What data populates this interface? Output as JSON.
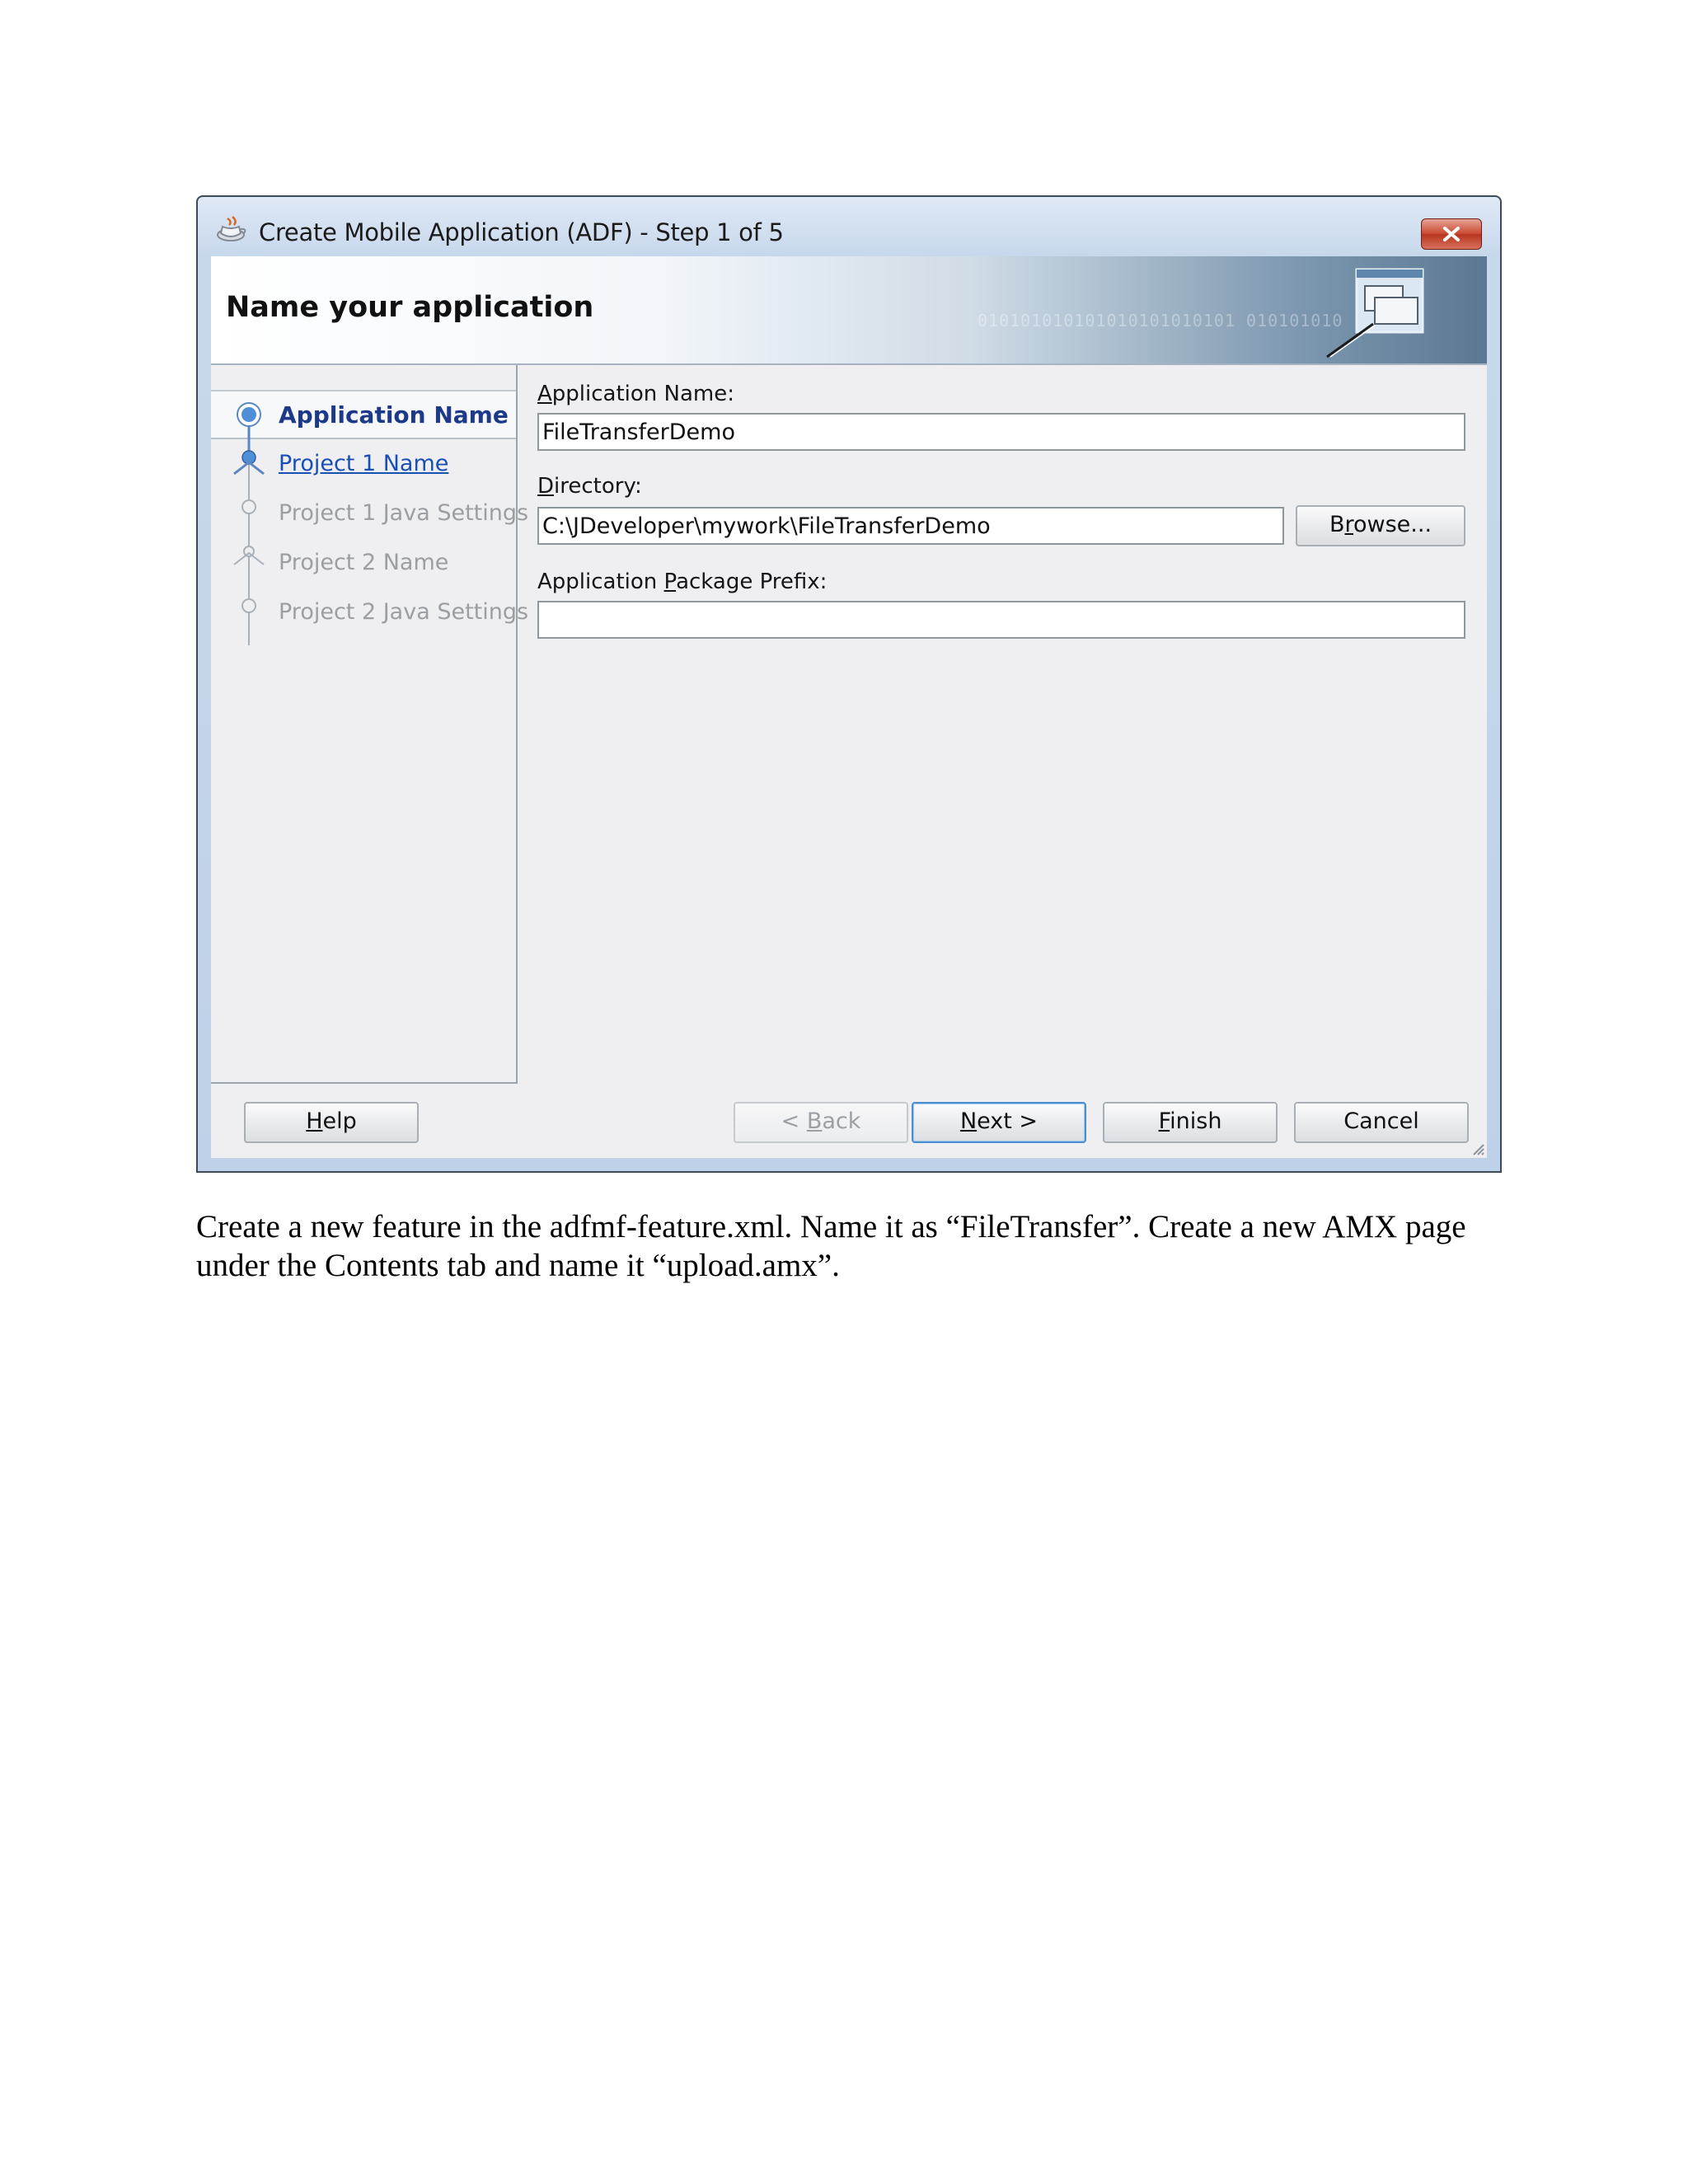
{
  "window": {
    "title": "Create Mobile Application (ADF) - Step 1 of 5",
    "header_title": "Name your application",
    "header_decoration": "010101010101010101010101 010101010"
  },
  "steps": [
    {
      "label": "Application Name",
      "state": "active"
    },
    {
      "label": "Project 1 Name",
      "state": "link"
    },
    {
      "label": "Project 1 Java Settings",
      "state": "disabled"
    },
    {
      "label": "Project 2 Name",
      "state": "disabled"
    },
    {
      "label": "Project 2 Java Settings",
      "state": "disabled"
    }
  ],
  "form": {
    "app_name_label_m": "A",
    "app_name_label_rest": "pplication Name:",
    "app_name_value": "FileTransferDemo",
    "directory_label_m": "D",
    "directory_label_rest": "irectory:",
    "directory_value": "C:\\JDeveloper\\mywork\\FileTransferDemo",
    "browse_pre": "B",
    "browse_m": "r",
    "browse_post": "owse...",
    "prefix_label_pre": "Application ",
    "prefix_label_m": "P",
    "prefix_label_post": "ackage Prefix:",
    "prefix_value": ""
  },
  "buttons": {
    "help_m": "H",
    "help_rest": "elp",
    "back_pre": "< ",
    "back_m": "B",
    "back_post": "ack",
    "next_m": "N",
    "next_post": "ext >",
    "finish_m": "F",
    "finish_post": "inish",
    "cancel": "Cancel"
  },
  "caption": "Create a new feature in the adfmf-feature.xml. Name it as “FileTransfer”. Create a new AMX page under the Contents tab and name it “upload.amx”.",
  "colors": {
    "link": "#1a4fb3",
    "active_step": "#1d3a8a",
    "disabled": "#9b9ea3",
    "close_button": "#c9472f"
  }
}
